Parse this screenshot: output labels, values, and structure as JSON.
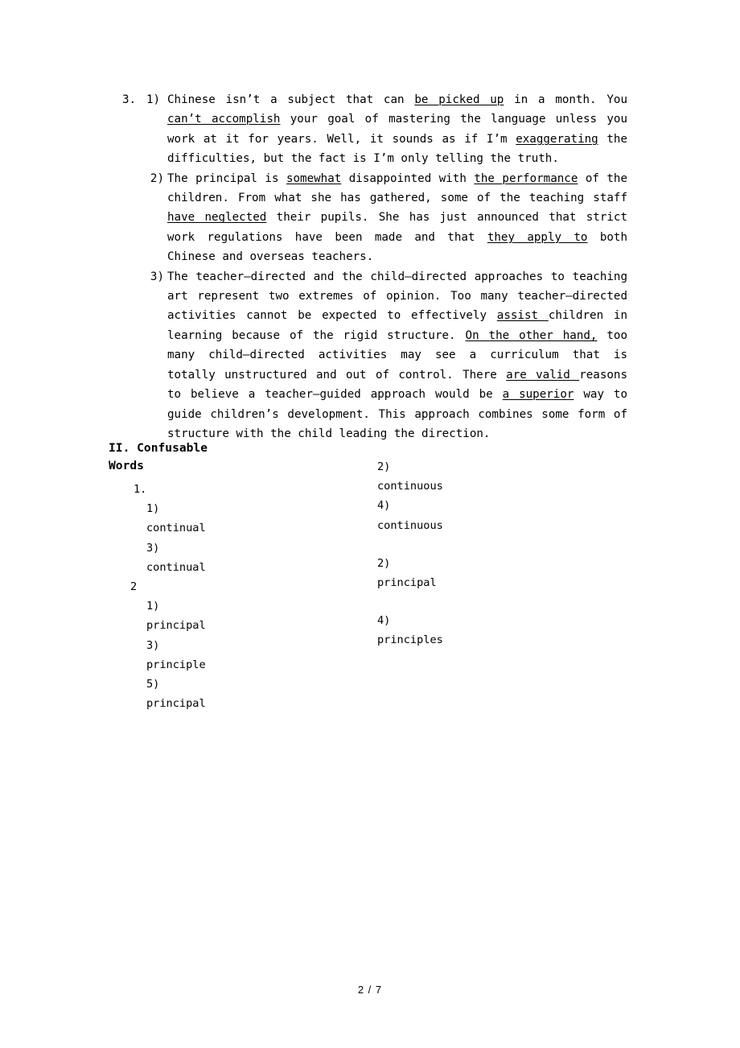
{
  "document": {
    "page_label": "2 / 7"
  },
  "section_one": {
    "number": "3.",
    "items": [
      {
        "marker": "1)",
        "runs": [
          {
            "t": "Chinese isn’t a subject that can ",
            "u": false
          },
          {
            "t": "be picked up",
            "u": true
          },
          {
            "t": " in a month. You ",
            "u": false
          },
          {
            "t": "can’t accomplish",
            "u": true
          },
          {
            "t": " your goal of mastering the language unless you work at it for years. Well, it sounds as if I’m ",
            "u": false
          },
          {
            "t": "exaggerating",
            "u": true
          },
          {
            "t": " the difficulties, but the fact is I’m only telling the truth.",
            "u": false
          }
        ]
      },
      {
        "marker": "2)",
        "runs": [
          {
            "t": "The principal is ",
            "u": false
          },
          {
            "t": "somewhat",
            "u": true
          },
          {
            "t": " disappointed with ",
            "u": false
          },
          {
            "t": "the performance",
            "u": true
          },
          {
            "t": " of the children. From what she has gathered, some of the teaching staff ",
            "u": false
          },
          {
            "t": "have neglected",
            "u": true
          },
          {
            "t": " their pupils. She has just announced that strict work regulations have been made and that ",
            "u": false
          },
          {
            "t": "they apply to",
            "u": true
          },
          {
            "t": " both Chinese and overseas teachers.",
            "u": false
          }
        ]
      },
      {
        "marker": "3)",
        "runs": [
          {
            "t": "The teacher–directed and the child–directed approaches to teaching art represent two extremes of opinion. Too many teacher–directed activities cannot be expected to effectively ",
            "u": false
          },
          {
            "t": "assist ",
            "u": true
          },
          {
            "t": "children in learning because of the rigid structure. ",
            "u": false
          },
          {
            "t": "On the other hand,",
            "u": true
          },
          {
            "t": " too many child–directed activities may see a curriculum that is totally unstructured and out of control. There ",
            "u": false
          },
          {
            "t": "are valid ",
            "u": true
          },
          {
            "t": "reasons to believe a teacher–guided approach would be ",
            "u": false
          },
          {
            "t": "a superior",
            "u": true
          },
          {
            "t": " way to guide children’s development. This approach combines some form of structure with the child leading the direction.",
            "u": false
          }
        ]
      }
    ]
  },
  "section_two": {
    "heading": "II. Confusable\nWords",
    "left_column": [
      {
        "text": "1.",
        "style": "num"
      },
      {
        "text": "1)",
        "style": "sub"
      },
      {
        "text": "continual",
        "style": "sub"
      },
      {
        "text": "3)",
        "style": "sub"
      },
      {
        "text": "continual",
        "style": "sub"
      },
      {
        "text": "2",
        "style": "num2"
      },
      {
        "text": "1)",
        "style": "sub"
      },
      {
        "text": "principal",
        "style": "sub"
      },
      {
        "text": "3)",
        "style": "sub"
      },
      {
        "text": "principle",
        "style": "sub"
      },
      {
        "text": "5)",
        "style": "sub"
      },
      {
        "text": "principal",
        "style": "sub"
      }
    ],
    "right_column": [
      {
        "text": "2)",
        "style": "plain"
      },
      {
        "text": "continuous",
        "style": "plain"
      },
      {
        "text": "4)",
        "style": "plain"
      },
      {
        "text": "continuous",
        "style": "plain"
      },
      {
        "text": "",
        "style": "gap"
      },
      {
        "text": "2)",
        "style": "plain"
      },
      {
        "text": "principal",
        "style": "plain"
      },
      {
        "text": "",
        "style": "gap"
      },
      {
        "text": "4)",
        "style": "plain"
      },
      {
        "text": "principles",
        "style": "plain"
      }
    ]
  }
}
